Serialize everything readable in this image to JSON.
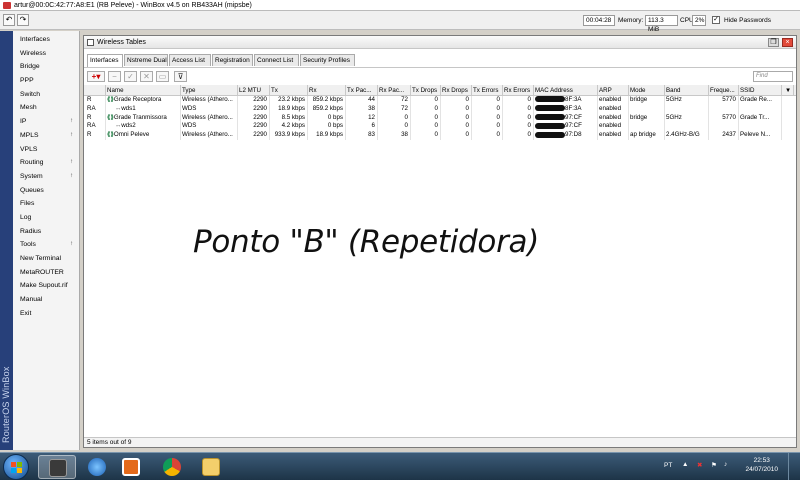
{
  "app": {
    "title": "artur@00:0C:42:77:A8:E1 (RB Peleve) - WinBox v4.5 on RB433AH (mipsbe)"
  },
  "toolbar": {
    "undo_icon": "undo-icon",
    "redo_icon": "redo-icon",
    "uptime": "00:04:28",
    "memory_label": "Memory:",
    "memory": "113.3 MiB",
    "cpu_label": "CPU:",
    "cpu": "2%",
    "hide_passwords_label": "Hide Passwords",
    "hide_passwords_checked": true
  },
  "sidebar": {
    "brand": "RouterOS WinBox",
    "items": [
      {
        "label": "Interfaces",
        "has_submenu": false
      },
      {
        "label": "Wireless",
        "has_submenu": false
      },
      {
        "label": "Bridge",
        "has_submenu": false
      },
      {
        "label": "PPP",
        "has_submenu": false
      },
      {
        "label": "Switch",
        "has_submenu": false
      },
      {
        "label": "Mesh",
        "has_submenu": false
      },
      {
        "label": "IP",
        "has_submenu": true
      },
      {
        "label": "MPLS",
        "has_submenu": true
      },
      {
        "label": "VPLS",
        "has_submenu": false
      },
      {
        "label": "Routing",
        "has_submenu": true
      },
      {
        "label": "System",
        "has_submenu": true
      },
      {
        "label": "Queues",
        "has_submenu": false
      },
      {
        "label": "Files",
        "has_submenu": false
      },
      {
        "label": "Log",
        "has_submenu": false
      },
      {
        "label": "Radius",
        "has_submenu": false
      },
      {
        "label": "Tools",
        "has_submenu": true
      },
      {
        "label": "New Terminal",
        "has_submenu": false
      },
      {
        "label": "MetaROUTER",
        "has_submenu": false
      },
      {
        "label": "Make Supout.rif",
        "has_submenu": false
      },
      {
        "label": "Manual",
        "has_submenu": false
      },
      {
        "label": "Exit",
        "has_submenu": false
      }
    ],
    "submenu_glyph": "↑"
  },
  "window": {
    "title": "Wireless Tables",
    "tabs": [
      "Interfaces",
      "Nstreme Dual",
      "Access List",
      "Registration",
      "Connect List",
      "Security Profiles"
    ],
    "active_tab": 0,
    "find_placeholder": "Find",
    "columns": [
      "",
      "Name",
      "Type",
      "L2 MTU",
      "Tx",
      "Rx",
      "Tx Pac...",
      "Rx Pac...",
      "Tx Drops",
      "Rx Drops",
      "Tx Errors",
      "Rx Errors",
      "MAC Address",
      "ARP",
      "Mode",
      "Band",
      "Freque...",
      "SSID"
    ],
    "column_menu_glyph": "▼",
    "rows": [
      {
        "flag": "R",
        "name": "Grade Receptora",
        "is_wds": false,
        "type": "Wireless (Athero...",
        "l2mtu": "2290",
        "tx": "23.2 kbps",
        "rx": "859.2 kbps",
        "txp": "44",
        "rxp": "72",
        "txd": "0",
        "rxd": "0",
        "txe": "0",
        "rxe": "0",
        "mac": "8F:3A",
        "arp": "enabled",
        "mode": "bridge",
        "band": "5GHz",
        "freq": "5770",
        "ssid": "Grade Re..."
      },
      {
        "flag": "RA",
        "name": "wds1",
        "is_wds": true,
        "type": "WDS",
        "l2mtu": "2290",
        "tx": "18.9 kbps",
        "rx": "859.2 kbps",
        "txp": "38",
        "rxp": "72",
        "txd": "0",
        "rxd": "0",
        "txe": "0",
        "rxe": "0",
        "mac": "8F:3A",
        "arp": "enabled",
        "mode": "",
        "band": "",
        "freq": "",
        "ssid": ""
      },
      {
        "flag": "R",
        "name": "Grade Tranmissora",
        "is_wds": false,
        "type": "Wireless (Athero...",
        "l2mtu": "2290",
        "tx": "8.5 kbps",
        "rx": "0 bps",
        "txp": "12",
        "rxp": "0",
        "txd": "0",
        "rxd": "0",
        "txe": "0",
        "rxe": "0",
        "mac": "97:CF",
        "arp": "enabled",
        "mode": "bridge",
        "band": "5GHz",
        "freq": "5770",
        "ssid": "Grade Tr..."
      },
      {
        "flag": "RA",
        "name": "wds2",
        "is_wds": true,
        "type": "WDS",
        "l2mtu": "2290",
        "tx": "4.2 kbps",
        "rx": "0 bps",
        "txp": "6",
        "rxp": "0",
        "txd": "0",
        "rxd": "0",
        "txe": "0",
        "rxe": "0",
        "mac": "97:CF",
        "arp": "enabled",
        "mode": "",
        "band": "",
        "freq": "",
        "ssid": ""
      },
      {
        "flag": "R",
        "name": "Omni Peleve",
        "is_wds": false,
        "type": "Wireless (Athero...",
        "l2mtu": "2290",
        "tx": "933.9 kbps",
        "rx": "18.9 kbps",
        "txp": "83",
        "rxp": "38",
        "txd": "0",
        "rxd": "0",
        "txe": "0",
        "rxe": "0",
        "mac": "97:D8",
        "arp": "enabled",
        "mode": "ap bridge",
        "band": "2.4GHz-B/G",
        "freq": "2437",
        "ssid": "Peleve N..."
      }
    ],
    "status": "5 items out of 9"
  },
  "overlay_text": "Ponto \"B\" (Repetidora)",
  "taskbar": {
    "apps": [
      "start-button",
      "winbox-app",
      "internet-explorer",
      "media-player",
      "chrome",
      "file-explorer"
    ],
    "language": "PT",
    "time": "22:53",
    "date": "24/07/2010"
  }
}
